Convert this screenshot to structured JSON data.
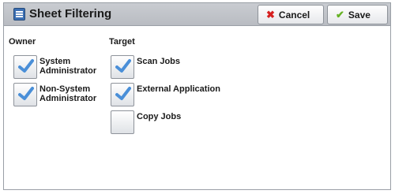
{
  "header": {
    "title": "Sheet Filtering",
    "title_icon": "sheet-filtering-icon",
    "cancel_label": "Cancel",
    "cancel_icon": "x-icon",
    "save_label": "Save",
    "save_icon": "checkmark-icon"
  },
  "owner": {
    "label": "Owner",
    "options": [
      {
        "label": "System\nAdministrator",
        "checked": true
      },
      {
        "label": "Non-System\nAdministrator",
        "checked": true
      }
    ]
  },
  "target": {
    "label": "Target",
    "options": [
      {
        "label": "Scan Jobs",
        "checked": true
      },
      {
        "label": "External Application",
        "checked": true
      },
      {
        "label": "Copy Jobs",
        "checked": false
      }
    ]
  },
  "colors": {
    "check": "#4a8fd8",
    "cancel": "#d62020",
    "save": "#66b224"
  }
}
